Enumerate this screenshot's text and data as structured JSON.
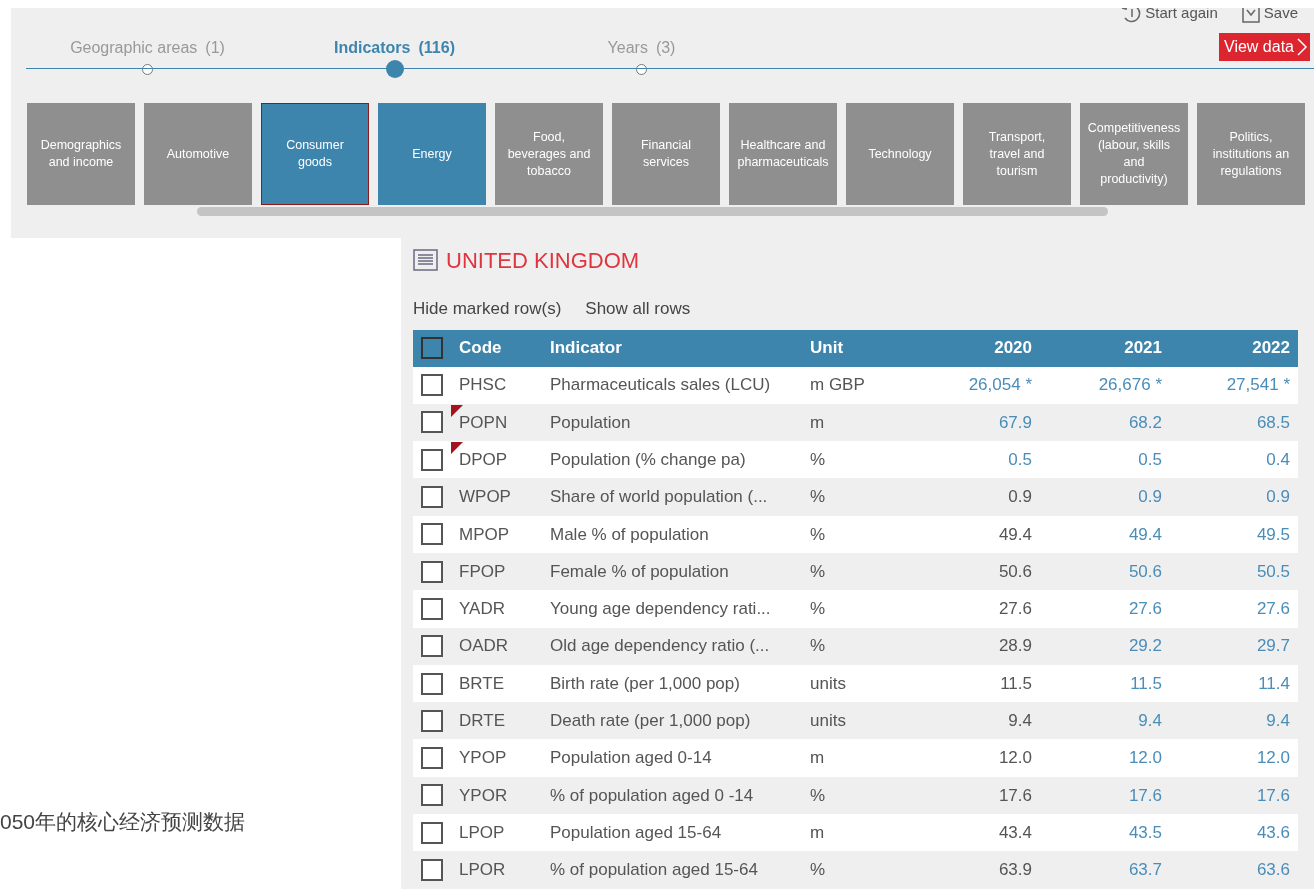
{
  "header_actions": [
    {
      "kind": "restart",
      "label": "Start again"
    },
    {
      "kind": "save",
      "label": "Save"
    }
  ],
  "steps": [
    {
      "label": "Geographic areas",
      "count": "(1)",
      "selected": false
    },
    {
      "label": "Indicators",
      "count": "(116)",
      "selected": true
    },
    {
      "label": "Years",
      "count": "(3)",
      "selected": false
    }
  ],
  "view_data_button": {
    "label": "View data"
  },
  "categories": [
    {
      "label": "Demographics\nand income",
      "selected": false,
      "focused": false
    },
    {
      "label": "Automotive",
      "selected": false,
      "focused": false
    },
    {
      "label": "Consumer\ngoods",
      "selected": true,
      "focused": true
    },
    {
      "label": "Energy",
      "selected": true,
      "focused": false
    },
    {
      "label": "Food,\nbeverages and\ntobacco",
      "selected": false,
      "focused": false
    },
    {
      "label": "Financial\nservices",
      "selected": false,
      "focused": false
    },
    {
      "label": "Healthcare and\npharmaceuticals",
      "selected": false,
      "focused": false
    },
    {
      "label": "Technology",
      "selected": false,
      "focused": false
    },
    {
      "label": "Transport,\ntravel and\ntourism",
      "selected": false,
      "focused": false
    },
    {
      "label": "Competitiveness\n(labour, skills\nand\nproductivity)",
      "selected": false,
      "focused": false
    },
    {
      "label": "Politics,\ninstitutions an\nregulations",
      "selected": false,
      "focused": false
    }
  ],
  "side_text": "050年的核心经济预测数据",
  "country_title": "UNITED KINGDOM",
  "row_actions": [
    "Hide marked row(s)",
    "Show all rows"
  ],
  "table": {
    "select_all_checked": false,
    "columns": [
      "Code",
      "Indicator",
      "Unit",
      "2020",
      "2021",
      "2022"
    ],
    "rows": [
      {
        "checked": false,
        "flagged": false,
        "code": "PHSC",
        "indicator": "Pharmaceuticals sales (LCU)",
        "unit": "m GBP",
        "values": [
          {
            "text": "26,054 *",
            "linked": true
          },
          {
            "text": "26,676 *",
            "linked": true
          },
          {
            "text": "27,541 *",
            "linked": true
          }
        ]
      },
      {
        "checked": false,
        "flagged": true,
        "code": "POPN",
        "indicator": "Population",
        "unit": "m",
        "values": [
          {
            "text": "67.9",
            "linked": true
          },
          {
            "text": "68.2",
            "linked": true
          },
          {
            "text": "68.5",
            "linked": true
          }
        ]
      },
      {
        "checked": false,
        "flagged": true,
        "code": "DPOP",
        "indicator": "Population (% change pa)",
        "unit": "%",
        "values": [
          {
            "text": "0.5",
            "linked": true
          },
          {
            "text": "0.5",
            "linked": true
          },
          {
            "text": "0.4",
            "linked": true
          }
        ]
      },
      {
        "checked": false,
        "flagged": false,
        "code": "WPOP",
        "indicator": "Share of world population (...",
        "unit": "%",
        "values": [
          {
            "text": "0.9",
            "linked": false
          },
          {
            "text": "0.9",
            "linked": true
          },
          {
            "text": "0.9",
            "linked": true
          }
        ]
      },
      {
        "checked": false,
        "flagged": false,
        "code": "MPOP",
        "indicator": "Male % of population",
        "unit": "%",
        "values": [
          {
            "text": "49.4",
            "linked": false
          },
          {
            "text": "49.4",
            "linked": true
          },
          {
            "text": "49.5",
            "linked": true
          }
        ]
      },
      {
        "checked": false,
        "flagged": false,
        "code": "FPOP",
        "indicator": "Female % of population",
        "unit": "%",
        "values": [
          {
            "text": "50.6",
            "linked": false
          },
          {
            "text": "50.6",
            "linked": true
          },
          {
            "text": "50.5",
            "linked": true
          }
        ]
      },
      {
        "checked": false,
        "flagged": false,
        "code": "YADR",
        "indicator": "Young age dependency rati...",
        "unit": "%",
        "values": [
          {
            "text": "27.6",
            "linked": false
          },
          {
            "text": "27.6",
            "linked": true
          },
          {
            "text": "27.6",
            "linked": true
          }
        ]
      },
      {
        "checked": false,
        "flagged": false,
        "code": "OADR",
        "indicator": "Old age dependency ratio (...",
        "unit": "%",
        "values": [
          {
            "text": "28.9",
            "linked": false
          },
          {
            "text": "29.2",
            "linked": true
          },
          {
            "text": "29.7",
            "linked": true
          }
        ]
      },
      {
        "checked": false,
        "flagged": false,
        "code": "BRTE",
        "indicator": "Birth rate (per 1,000 pop)",
        "unit": "units",
        "values": [
          {
            "text": "11.5",
            "linked": false
          },
          {
            "text": "11.5",
            "linked": true
          },
          {
            "text": "11.4",
            "linked": true
          }
        ]
      },
      {
        "checked": false,
        "flagged": false,
        "code": "DRTE",
        "indicator": "Death rate (per 1,000 pop)",
        "unit": "units",
        "values": [
          {
            "text": "9.4",
            "linked": false
          },
          {
            "text": "9.4",
            "linked": true
          },
          {
            "text": "9.4",
            "linked": true
          }
        ]
      },
      {
        "checked": false,
        "flagged": false,
        "code": "YPOP",
        "indicator": "Population aged 0-14",
        "unit": "m",
        "values": [
          {
            "text": "12.0",
            "linked": false
          },
          {
            "text": "12.0",
            "linked": true
          },
          {
            "text": "12.0",
            "linked": true
          }
        ]
      },
      {
        "checked": false,
        "flagged": false,
        "code": "YPOR",
        "indicator": "% of population aged 0 -14",
        "unit": "%",
        "values": [
          {
            "text": "17.6",
            "linked": false
          },
          {
            "text": "17.6",
            "linked": true
          },
          {
            "text": "17.6",
            "linked": true
          }
        ]
      },
      {
        "checked": false,
        "flagged": false,
        "code": "LPOP",
        "indicator": "Population aged 15-64",
        "unit": "m",
        "values": [
          {
            "text": "43.4",
            "linked": false
          },
          {
            "text": "43.5",
            "linked": true
          },
          {
            "text": "43.6",
            "linked": true
          }
        ]
      },
      {
        "checked": false,
        "flagged": false,
        "code": "LPOR",
        "indicator": "% of population aged 15-64",
        "unit": "%",
        "values": [
          {
            "text": "63.9",
            "linked": false
          },
          {
            "text": "63.7",
            "linked": true
          },
          {
            "text": "63.6",
            "linked": true
          }
        ]
      }
    ]
  }
}
